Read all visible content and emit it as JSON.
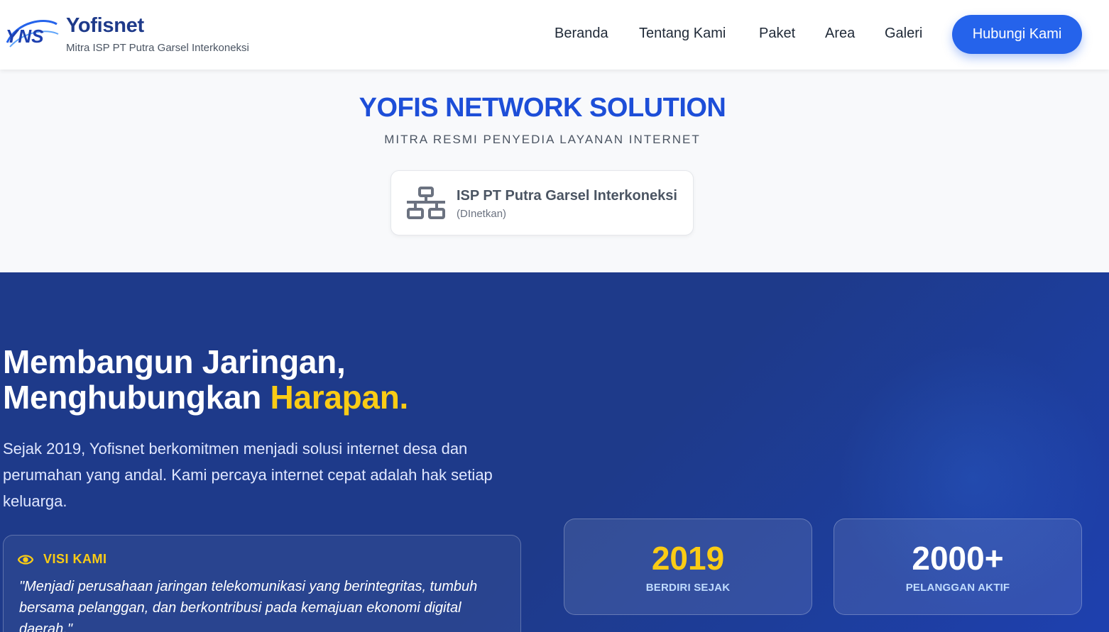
{
  "header": {
    "brand_name": "Yofisnet",
    "brand_tagline": "Mitra ISP PT Putra Garsel Interkoneksi",
    "logo_icon": "yns-logo-icon",
    "nav": [
      {
        "label": "Beranda"
      },
      {
        "label": "Tentang Kami"
      },
      {
        "label": "Paket"
      },
      {
        "label": "Area"
      },
      {
        "label": "Galeri"
      }
    ],
    "cta_label": "Hubungi Kami"
  },
  "banner": {
    "title": "YOFIS NETWORK SOLUTION",
    "subtitle": "MITRA RESMI PENYEDIA LAYANAN INTERNET",
    "isp": {
      "icon": "network-icon",
      "name": "ISP PT Putra Garsel Interkoneksi",
      "alias": "(DInetkan)"
    }
  },
  "hero": {
    "headline_line1": "Membangun Jaringan,",
    "headline_line2": "Menghubungkan ",
    "headline_accent": "Harapan.",
    "description": "Sejak 2019, Yofisnet berkomitmen menjadi solusi internet desa dan perumahan yang andal. Kami percaya internet cepat adalah hak setiap keluarga.",
    "visi": {
      "icon": "eye-icon",
      "label": "VISI KAMI",
      "quote": "\"Menjadi perusahaan jaringan telekomunikasi yang berintegritas, tumbuh bersama pelanggan, dan berkontribusi pada kemajuan ekonomi digital daerah.\""
    },
    "stats": [
      {
        "value": "2019",
        "label": "BERDIRI SEJAK",
        "color": "#facc15"
      },
      {
        "value": "2000+",
        "label": "PELANGGAN AKTIF",
        "color": "#ffffff"
      }
    ]
  },
  "colors": {
    "primary": "#2563eb",
    "navy": "#1e3a8a",
    "accent_yellow": "#facc15",
    "title_blue": "#1d4ed8"
  }
}
